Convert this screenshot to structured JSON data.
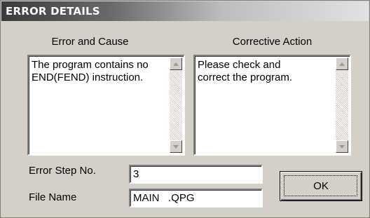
{
  "dialog": {
    "title": "ERROR DETAILS"
  },
  "error_panel": {
    "header": "Error and Cause",
    "text": "The program contains no\nEND(FEND) instruction."
  },
  "action_panel": {
    "header": "Corrective Action",
    "text": "Please check and\ncorrect the program."
  },
  "fields": {
    "error_step_label": "Error Step No.",
    "error_step_value": "3",
    "file_name_label": "File Name",
    "file_name_value": "MAIN   .QPG"
  },
  "buttons": {
    "ok_label": "OK"
  },
  "icons": {
    "scroll_up": "scroll-up-arrow-icon",
    "scroll_down": "scroll-down-arrow-icon"
  },
  "colors": {
    "dialog_face": "#d4d0c8",
    "title_text": "#ffffff",
    "field_background": "#ffffff"
  }
}
